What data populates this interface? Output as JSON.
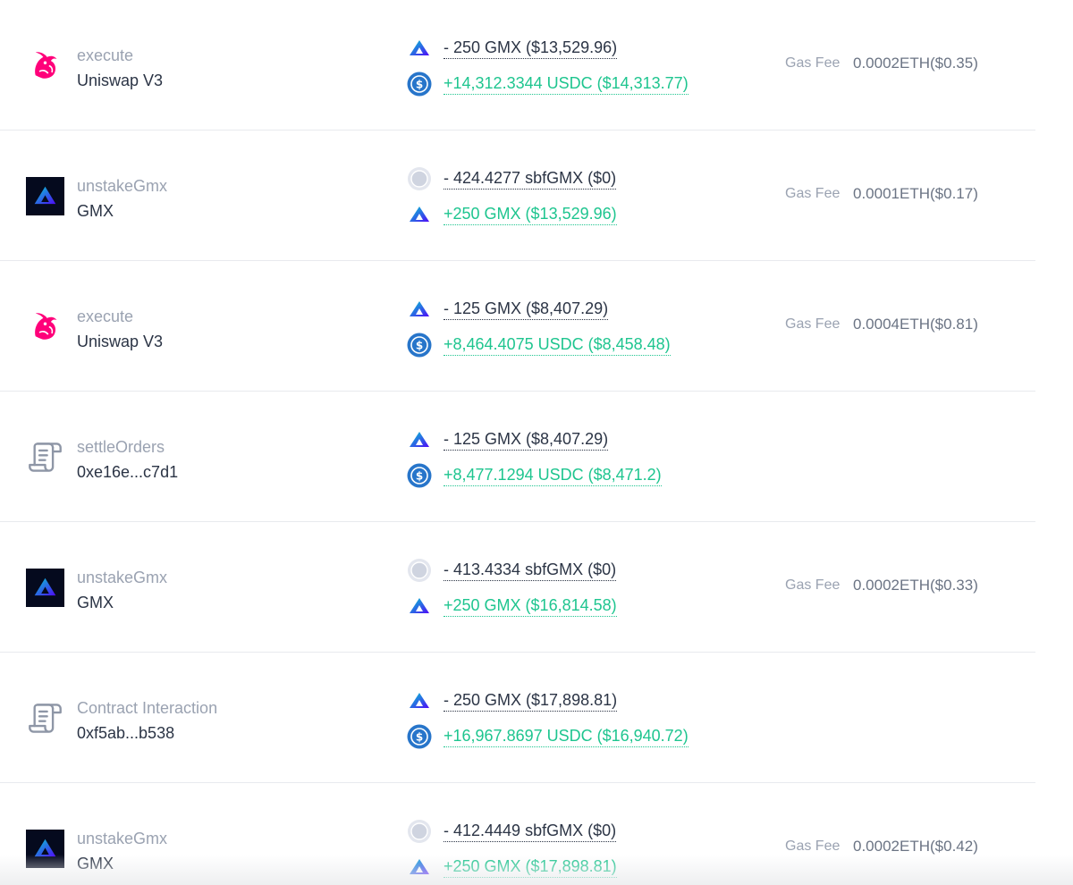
{
  "colors": {
    "negative_text": "#2b3445",
    "positive_text": "#1ec58f",
    "muted_text": "#9aa2b1",
    "uniswap_pink": "#ff007a",
    "gmx_blue": "#2d42fc",
    "usdc_blue": "#2775ca"
  },
  "transactions": [
    {
      "icon": "uniswap-icon",
      "method": "execute",
      "target": "Uniswap V3",
      "out": {
        "icon": "gmx-token-icon",
        "amount": "- 250 GMX ($13,529.96)"
      },
      "in": {
        "icon": "usdc-token-icon",
        "amount": "+14,312.3344 USDC ($14,313.77)"
      },
      "gas_label": "Gas Fee",
      "gas_value": "0.0002ETH($0.35)"
    },
    {
      "icon": "gmx-logo-icon",
      "method": "unstakeGmx",
      "target": "GMX",
      "out": {
        "icon": "sbfgmx-token-icon",
        "amount": "- 424.4277 sbfGMX ($0)"
      },
      "in": {
        "icon": "gmx-token-icon",
        "amount": "+250 GMX ($13,529.96)"
      },
      "gas_label": "Gas Fee",
      "gas_value": "0.0001ETH($0.17)"
    },
    {
      "icon": "uniswap-icon",
      "method": "execute",
      "target": "Uniswap V3",
      "out": {
        "icon": "gmx-token-icon",
        "amount": "- 125 GMX ($8,407.29)"
      },
      "in": {
        "icon": "usdc-token-icon",
        "amount": "+8,464.4075 USDC ($8,458.48)"
      },
      "gas_label": "Gas Fee",
      "gas_value": "0.0004ETH($0.81)"
    },
    {
      "icon": "contract-scroll-icon",
      "method": "settleOrders",
      "target": "0xe16e...c7d1",
      "out": {
        "icon": "gmx-token-icon",
        "amount": "- 125 GMX ($8,407.29)"
      },
      "in": {
        "icon": "usdc-token-icon",
        "amount": "+8,477.1294 USDC ($8,471.2)"
      },
      "gas_label": "",
      "gas_value": ""
    },
    {
      "icon": "gmx-logo-icon",
      "method": "unstakeGmx",
      "target": "GMX",
      "out": {
        "icon": "sbfgmx-token-icon",
        "amount": "- 413.4334 sbfGMX ($0)"
      },
      "in": {
        "icon": "gmx-token-icon",
        "amount": "+250 GMX ($16,814.58)"
      },
      "gas_label": "Gas Fee",
      "gas_value": "0.0002ETH($0.33)"
    },
    {
      "icon": "contract-scroll-icon",
      "method": "Contract Interaction",
      "target": "0xf5ab...b538",
      "out": {
        "icon": "gmx-token-icon",
        "amount": "- 250 GMX ($17,898.81)"
      },
      "in": {
        "icon": "usdc-token-icon",
        "amount": "+16,967.8697 USDC ($16,940.72)"
      },
      "gas_label": "",
      "gas_value": ""
    },
    {
      "icon": "gmx-logo-icon",
      "method": "unstakeGmx",
      "target": "GMX",
      "out": {
        "icon": "sbfgmx-token-icon",
        "amount": "- 412.4449 sbfGMX ($0)"
      },
      "in": {
        "icon": "gmx-token-icon",
        "amount": "+250 GMX ($17,898.81)"
      },
      "gas_label": "Gas Fee",
      "gas_value": "0.0002ETH($0.42)"
    }
  ]
}
